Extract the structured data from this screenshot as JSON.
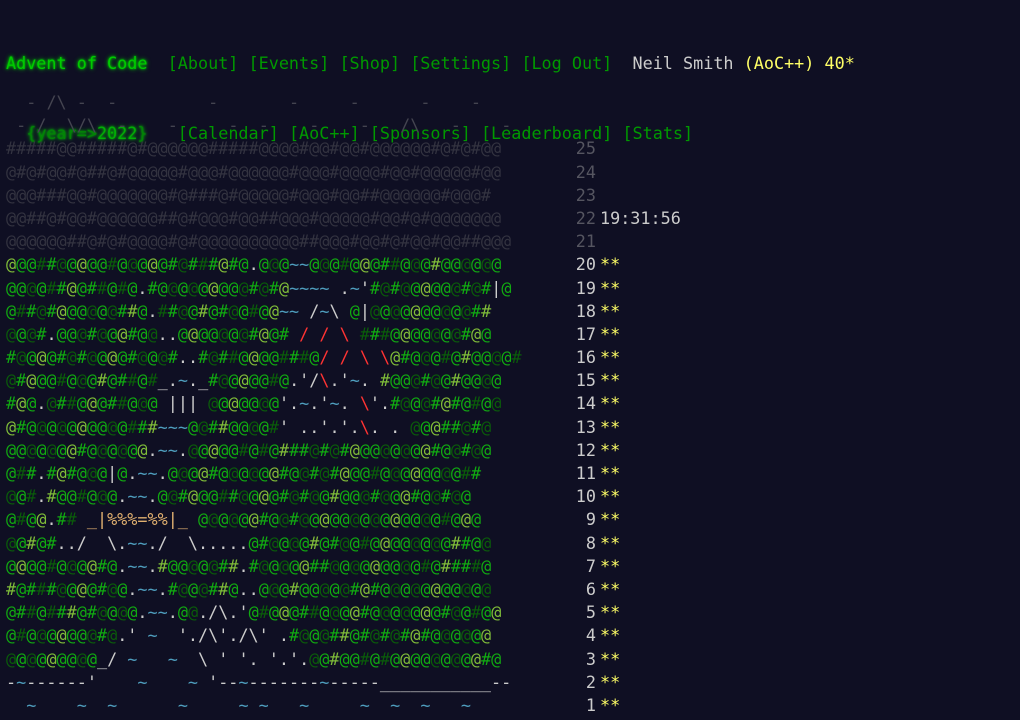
{
  "header": {
    "title": "Advent of Code",
    "nav": [
      "[About]",
      "[Events]",
      "[Shop]",
      "[Settings]",
      "[Log Out]"
    ],
    "user_name": "Neil Smith",
    "supporter": "(AoC++)",
    "star_total": "40*",
    "year_prefix": "{year=>",
    "year": "2022",
    "year_suffix": "}",
    "subnav": [
      "[Calendar]",
      "[AoC++]",
      "[Sponsors]",
      "[Leaderboard]",
      "[Stats]"
    ]
  },
  "colors": {
    "background": "#0f0f23",
    "green": "#00cc00",
    "gold": "#ffff66",
    "text": "#cccccc"
  },
  "calendar": {
    "lines": [
      {
        "art": "  - /\\ -  -         -       -     -      -    -"
      },
      {
        "art": " - /  \\/\\  -    -     -  -    -    -   /\\   -    -"
      },
      {
        "art": "#####@@#####@#@@@@@@#####@@@@#@@#@@#@@@@@@#@#@#@@",
        "day": "25"
      },
      {
        "art": "@#@#@@#@##@#@@@@@#@@@#@@@@@@#@@@#@@@@#@@#@@@@@#@@",
        "day": "24"
      },
      {
        "art": "@@@###@@#@@@@@@@#@###@#@@@@@#@@@#@@##@@@@@@#@@@#",
        "day": "23"
      },
      {
        "art": "@@##@#@@#@@@@@@##@#@@@#@@##@@@#@@@@@#@@#@#@@@@@@@",
        "day": "22",
        "time": "19:31:56"
      },
      {
        "art": "@@@@@@##@#@#@@@@#@#@@@@@@@@@@##@@@#@@#@#@@#@@##@@@",
        "day": "21"
      },
      {
        "art": "@@@##@@@@@#@@@@@#@###@#@.@@@~~@@@#@@@##@@@#@@@@@@",
        "day": "20",
        "stars": "**"
      },
      {
        "art": "@@@@##@@##@#@.#@@@@@@@@@#@#@~~~~ .~'#@#@@@@@@#@#|@",
        "day": "19",
        "stars": "**"
      },
      {
        "art": "@##@#@@@@@@##@.##@@#@#@@#@@~~ /~\\ @|@@@@@@@@@@##",
        "day": "18",
        "stars": "**"
      },
      {
        "art": "@@@#.@@@#@@@#@@..@@@@@@@#@@# / / \\ ###@@@@@@@#@@",
        "day": "17",
        "stars": "**"
      },
      {
        "art": "#@@@@#@#@@@@#@@@#..#@##@@@@###@/ / \\ \\@#@@@#@#@@@@#",
        "day": "16",
        "stars": "**"
      },
      {
        "art": "@#@@@#@@@#@##@#_.~._#@@@@@#@.'/\\.'~. #@@@#@@#@@@@",
        "day": "15",
        "stars": "**"
      },
      {
        "art": "#@@.@##@@@##@@@ ||| @@@@@@@'.~.'~. \\'.#@@@#@#@#@@",
        "day": "14",
        "stars": "**"
      },
      {
        "art": "@#@@@@@@@@@@###~~~@@##@@@@#' ..'.'.\\. . @@@##@#@",
        "day": "13",
        "stars": "**"
      },
      {
        "art": "@@@@@@@#@@@@@@.~~.@@@@@#@#@###@#@#@@@@@@@@#@@#@@",
        "day": "12",
        "stars": "**"
      },
      {
        "art": "@##.#@#@@@|@.~~.@@@@#@@@@@@#@@#@#@@@#@@@@@@@@##",
        "day": "11",
        "stars": "**"
      },
      {
        "art": "@@#.#@@#@@@.~~.@@#@@@##@@@@#@#@@#@@@#@@@#@@#@@",
        "day": "10",
        "stars": "**"
      },
      {
        "art": "@#@@.## _|%%%=%%|_ @@@@@@#@@#@@@@@@@@@@@@@@#@@@",
        "day": "9",
        "stars": "**"
      },
      {
        "art": "@@#@#../  \\.~~./  \\.....@#@@@@#@#@@#@@@@@@@@##@@",
        "day": "8",
        "stars": "**"
      },
      {
        "art": "@@@@#@@@@#@.~~.#@@@@@##.#@@@@@##@@@@@@@@@#@####@",
        "day": "7",
        "stars": "**"
      },
      {
        "art": "#@###@@@@#@@.~~.#@@@##@..@@@#@@@@@#@#@@@@@@@@@@@",
        "day": "6",
        "stars": "**"
      },
      {
        "art": "@##@###@#@@@@.~~.@@./\\.'@#@@@##@@@@#@@@@@@@#@@#@@",
        "day": "5",
        "stars": "**"
      },
      {
        "art": "@#@@@@@@@#@.' ~  './\\'./\\' .#@@@##@#@#@#@#@@@@@@",
        "day": "4",
        "stars": "**"
      },
      {
        "art": "@@@@@@@@@_/ ~   ~  \\ ' '. '.'.@@#@@#@#@@@@@@@@@#@",
        "day": "3",
        "stars": "**"
      },
      {
        "art": "-~------'    ~    ~ '--~-------~-----___________--",
        "day": "2",
        "stars": "**"
      },
      {
        "art": "  ~    ~  ~      ~     ~ ~   ~     ~  ~  ~   ~",
        "day": "1",
        "stars": "**"
      }
    ]
  }
}
